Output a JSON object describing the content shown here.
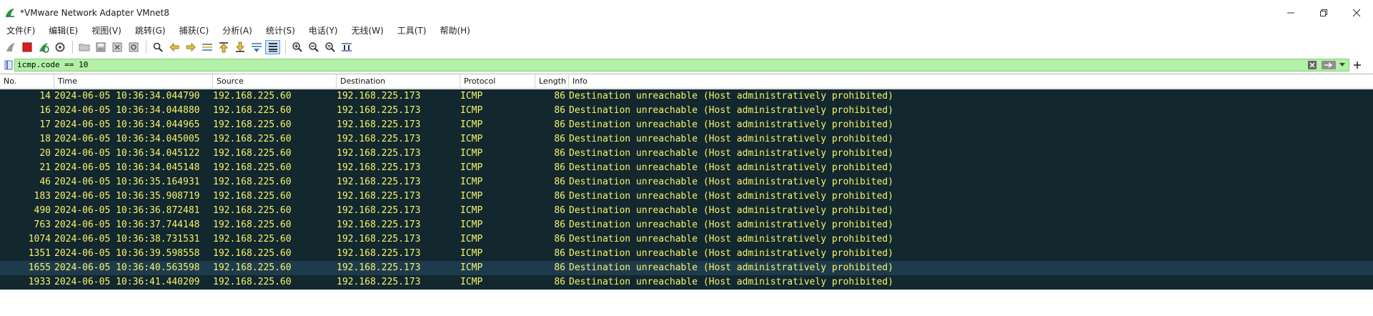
{
  "window": {
    "title": "*VMware Network Adapter VMnet8",
    "controls": [
      "minimize",
      "maximize",
      "close"
    ]
  },
  "menu": [
    "文件(F)",
    "编辑(E)",
    "视图(V)",
    "跳转(G)",
    "捕获(C)",
    "分析(A)",
    "统计(S)",
    "电话(Y)",
    "无线(W)",
    "工具(T)",
    "帮助(H)"
  ],
  "toolbar": {
    "icons": [
      "shark-fin-icon",
      "stop-capture-icon",
      "restart-capture-icon",
      "capture-options-icon",
      "open-file-icon",
      "save-file-icon",
      "close-file-icon",
      "reload-file-icon",
      "find-packet-icon",
      "go-back-icon",
      "go-forward-icon",
      "go-to-packet-icon",
      "first-packet-icon",
      "last-packet-icon",
      "autoscroll-icon",
      "colorize-icon",
      "zoom-in-icon",
      "zoom-out-icon",
      "normal-size-icon",
      "resize-columns-icon"
    ]
  },
  "filter": {
    "value": "icmp.code == 10"
  },
  "columns": [
    "No.",
    "Time",
    "Source",
    "Destination",
    "Protocol",
    "Length",
    "Info"
  ],
  "packets": [
    {
      "no": "14",
      "time": "2024-06-05 10:36:34.044790",
      "src": "192.168.225.60",
      "dst": "192.168.225.173",
      "proto": "ICMP",
      "len": "86",
      "info": "Destination unreachable (Host administratively prohibited)"
    },
    {
      "no": "16",
      "time": "2024-06-05 10:36:34.044880",
      "src": "192.168.225.60",
      "dst": "192.168.225.173",
      "proto": "ICMP",
      "len": "86",
      "info": "Destination unreachable (Host administratively prohibited)"
    },
    {
      "no": "17",
      "time": "2024-06-05 10:36:34.044965",
      "src": "192.168.225.60",
      "dst": "192.168.225.173",
      "proto": "ICMP",
      "len": "86",
      "info": "Destination unreachable (Host administratively prohibited)"
    },
    {
      "no": "18",
      "time": "2024-06-05 10:36:34.045005",
      "src": "192.168.225.60",
      "dst": "192.168.225.173",
      "proto": "ICMP",
      "len": "86",
      "info": "Destination unreachable (Host administratively prohibited)"
    },
    {
      "no": "20",
      "time": "2024-06-05 10:36:34.045122",
      "src": "192.168.225.60",
      "dst": "192.168.225.173",
      "proto": "ICMP",
      "len": "86",
      "info": "Destination unreachable (Host administratively prohibited)"
    },
    {
      "no": "21",
      "time": "2024-06-05 10:36:34.045148",
      "src": "192.168.225.60",
      "dst": "192.168.225.173",
      "proto": "ICMP",
      "len": "86",
      "info": "Destination unreachable (Host administratively prohibited)"
    },
    {
      "no": "46",
      "time": "2024-06-05 10:36:35.164931",
      "src": "192.168.225.60",
      "dst": "192.168.225.173",
      "proto": "ICMP",
      "len": "86",
      "info": "Destination unreachable (Host administratively prohibited)"
    },
    {
      "no": "183",
      "time": "2024-06-05 10:36:35.908719",
      "src": "192.168.225.60",
      "dst": "192.168.225.173",
      "proto": "ICMP",
      "len": "86",
      "info": "Destination unreachable (Host administratively prohibited)"
    },
    {
      "no": "490",
      "time": "2024-06-05 10:36:36.872481",
      "src": "192.168.225.60",
      "dst": "192.168.225.173",
      "proto": "ICMP",
      "len": "86",
      "info": "Destination unreachable (Host administratively prohibited)"
    },
    {
      "no": "763",
      "time": "2024-06-05 10:36:37.744148",
      "src": "192.168.225.60",
      "dst": "192.168.225.173",
      "proto": "ICMP",
      "len": "86",
      "info": "Destination unreachable (Host administratively prohibited)"
    },
    {
      "no": "1074",
      "time": "2024-06-05 10:36:38.731531",
      "src": "192.168.225.60",
      "dst": "192.168.225.173",
      "proto": "ICMP",
      "len": "86",
      "info": "Destination unreachable (Host administratively prohibited)"
    },
    {
      "no": "1351",
      "time": "2024-06-05 10:36:39.598558",
      "src": "192.168.225.60",
      "dst": "192.168.225.173",
      "proto": "ICMP",
      "len": "86",
      "info": "Destination unreachable (Host administratively prohibited)"
    },
    {
      "no": "1655",
      "time": "2024-06-05 10:36:40.563598",
      "src": "192.168.225.60",
      "dst": "192.168.225.173",
      "proto": "ICMP",
      "len": "86",
      "info": "Destination unreachable (Host administratively prohibited)",
      "selected": true
    },
    {
      "no": "1933",
      "time": "2024-06-05 10:36:41.440209",
      "src": "192.168.225.60",
      "dst": "192.168.225.173",
      "proto": "ICMP",
      "len": "86",
      "info": "Destination unreachable (Host administratively prohibited)"
    }
  ],
  "colors": {
    "row_background": "#12272e",
    "row_text": "#f7f36a",
    "selected_row": "#1e3b4d",
    "filter_valid": "#b3f0a8"
  }
}
